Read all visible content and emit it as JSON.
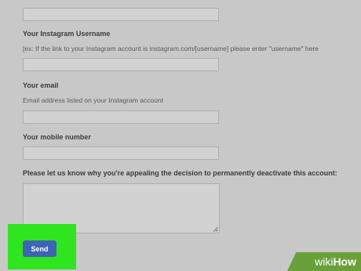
{
  "form": {
    "instagram_username": {
      "label": "Your Instagram Username",
      "hint": "[ex: If the link to your Instagram account is instagram.com/[username] please enter \"username\" here",
      "value": ""
    },
    "email": {
      "label": "Your email",
      "hint": "Email address listed on your Instagram account",
      "value": ""
    },
    "mobile": {
      "label": "Your mobile number",
      "value": ""
    },
    "appeal_reason": {
      "label": "Please let us know why you're appealing the decision to permanently deactivate this account:",
      "value": ""
    },
    "send_label": "Send"
  },
  "watermark": {
    "wiki": "wiki",
    "how": "How"
  },
  "colors": {
    "highlight": "#2fe51f",
    "send_button": "#3f64b4",
    "watermark": "#6aa03a"
  }
}
